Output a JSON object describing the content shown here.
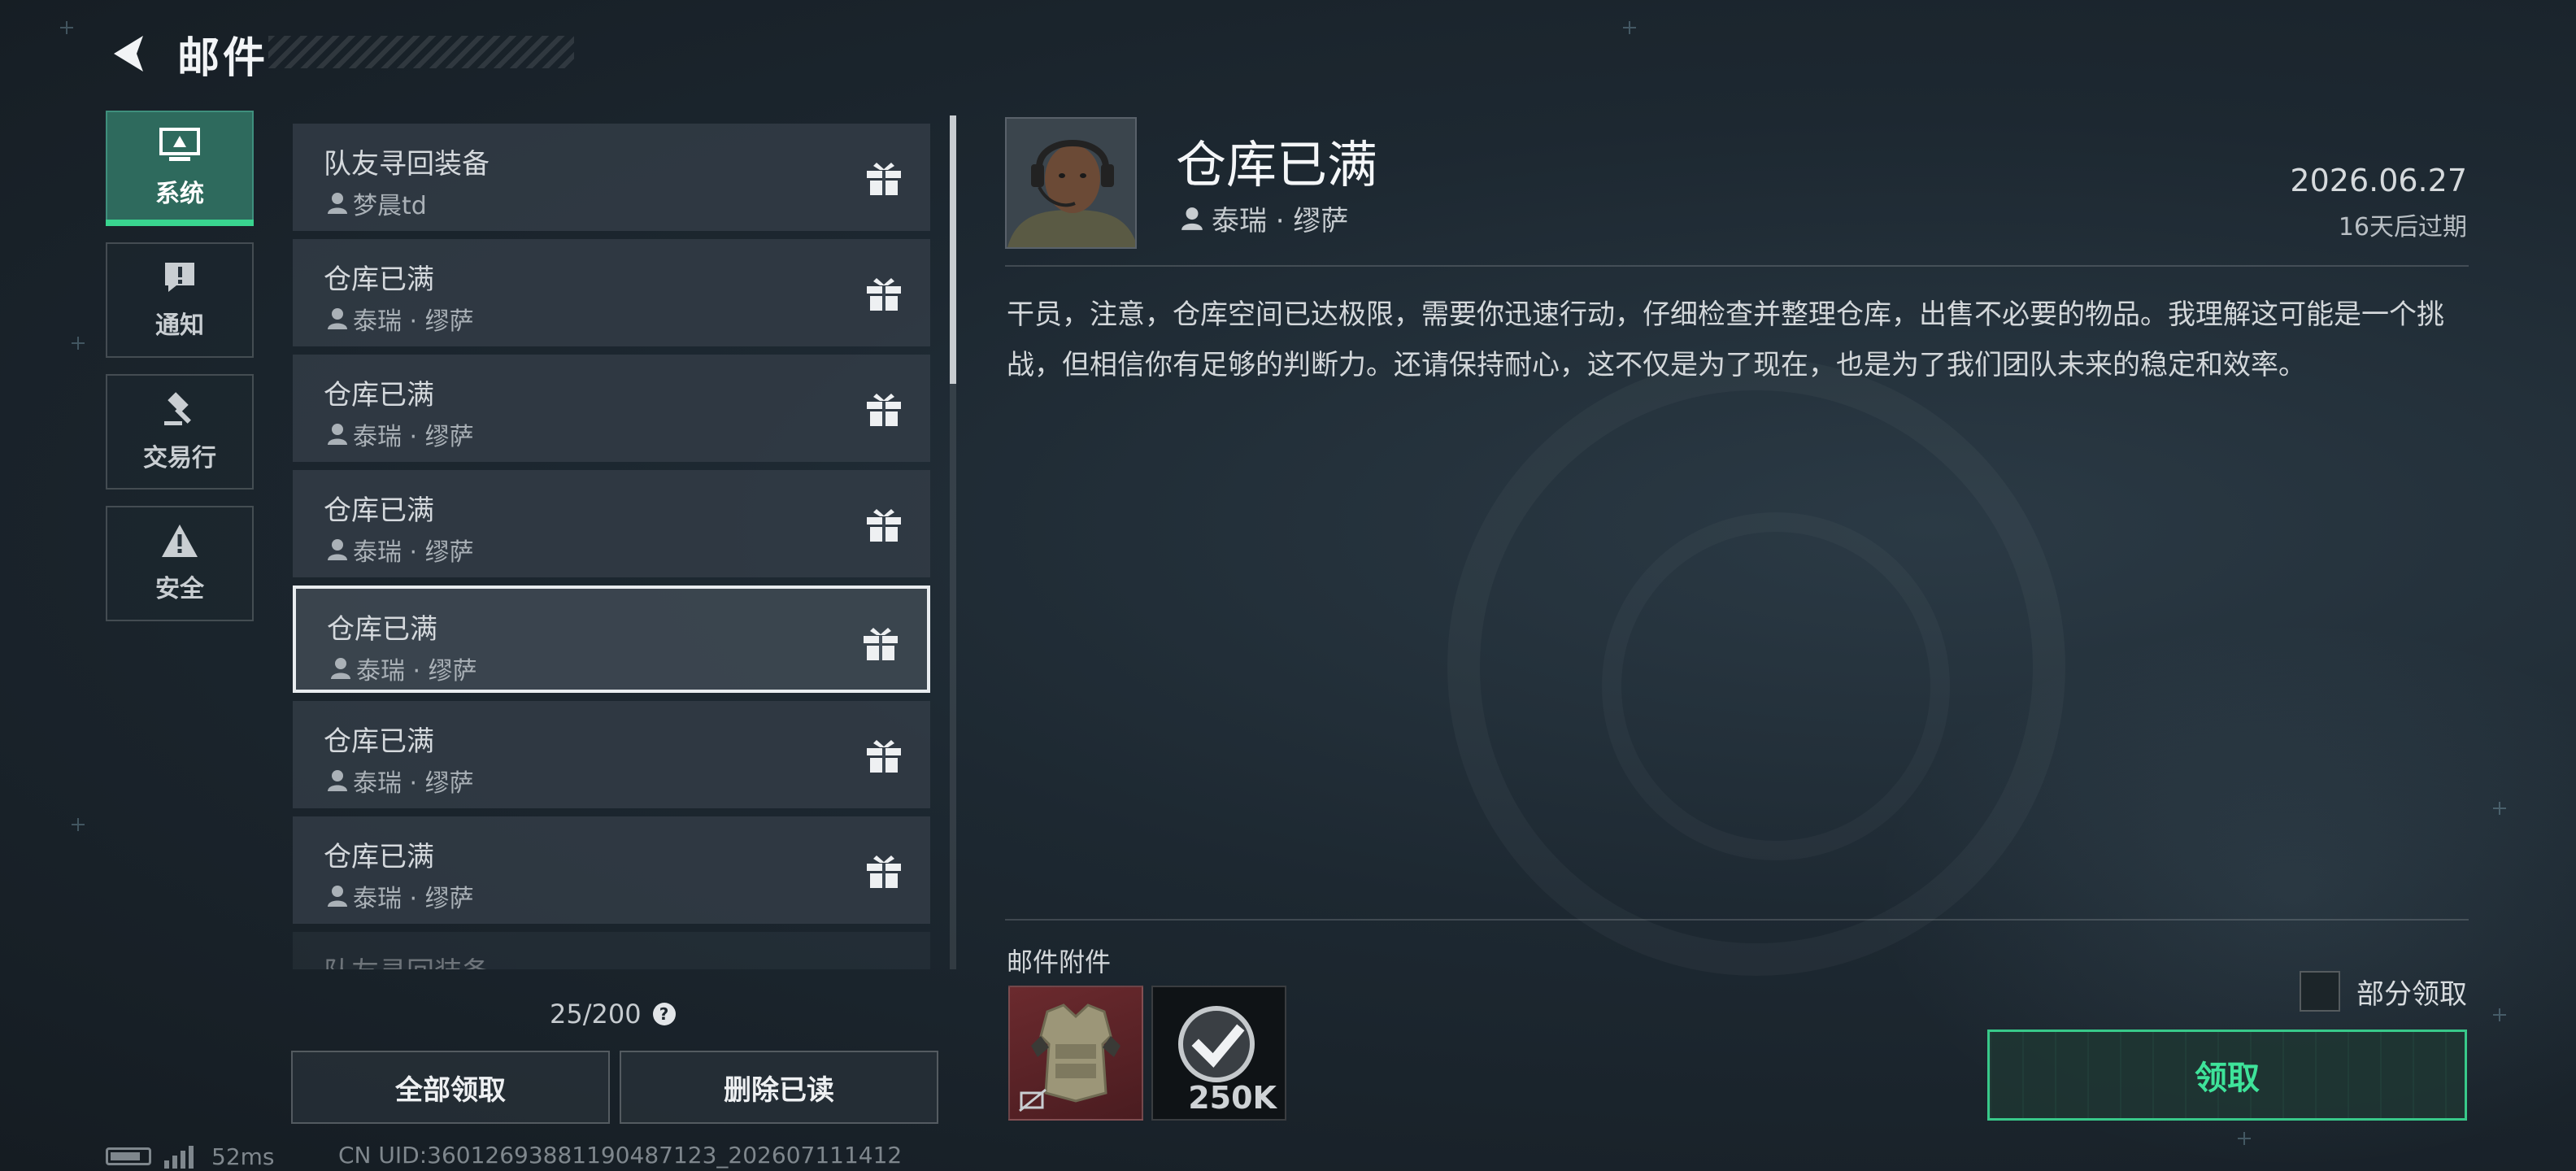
{
  "header": {
    "title": "邮件"
  },
  "categories": [
    {
      "label": "系统",
      "icon": "monitor-icon",
      "active": true
    },
    {
      "label": "通知",
      "icon": "alert-icon",
      "active": false
    },
    {
      "label": "交易行",
      "icon": "gavel-icon",
      "active": false
    },
    {
      "label": "安全",
      "icon": "warning-icon",
      "active": false
    }
  ],
  "mail_list": [
    {
      "title": "队友寻回装备",
      "sender": "梦晨td"
    },
    {
      "title": "仓库已满",
      "sender": "泰瑞 · 缪萨"
    },
    {
      "title": "仓库已满",
      "sender": "泰瑞 · 缪萨"
    },
    {
      "title": "仓库已满",
      "sender": "泰瑞 · 缪萨"
    },
    {
      "title": "仓库已满",
      "sender": "泰瑞 · 缪萨",
      "selected": true
    },
    {
      "title": "仓库已满",
      "sender": "泰瑞 · 缪萨"
    },
    {
      "title": "仓库已满",
      "sender": "泰瑞 · 缪萨"
    },
    {
      "title": "队友寻回装备",
      "sender": ""
    }
  ],
  "list_footer": {
    "count": "25/200",
    "help": "?",
    "claim_all_label": "全部领取",
    "delete_read_label": "删除已读"
  },
  "status_bar": {
    "ping": "52ms",
    "uid": "CN UID:36012693881190487123_202607111412"
  },
  "detail": {
    "title": "仓库已满",
    "sender": "泰瑞 · 缪萨",
    "date": "2026.06.27",
    "expire": "16天后过期",
    "body": "干员，注意，仓库空间已达极限，需要你迅速行动，仔细检查并整理仓库，出售不必要的物品。我理解这可能是一个挑战，但相信你有足够的判断力。还请保持耐心，这不仅是为了现在，也是为了我们团队未来的稳定和效率。",
    "attachments_label": "邮件附件",
    "attachments": [
      {
        "icon": "armor-vest-icon",
        "bound": true
      },
      {
        "icon": "currency-check-icon",
        "qty": "250K"
      }
    ],
    "partial_claim_label": "部分领取",
    "claim_label": "领取"
  },
  "colors": {
    "accent_green": "#3ee39a",
    "active_tab": "#2e6a5d",
    "background": "#1d2831"
  }
}
